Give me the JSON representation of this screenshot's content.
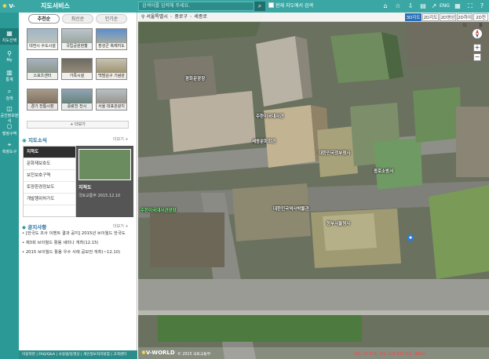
{
  "header": {
    "logo_text": "V-WORLD",
    "title": "지도서비스",
    "search_placeholder": "검색어를 입력해 주세요.",
    "search_in_map_label": "현재 지도에서 검색",
    "lang_label": "ENG",
    "accent_color": "#3aa7a4"
  },
  "leftnav": {
    "items": [
      {
        "label": "지도선택",
        "icon": "map-select-icon"
      },
      {
        "label": "My",
        "icon": "person-icon"
      },
      {
        "label": "통계",
        "icon": "stats-icon"
      },
      {
        "label": "검색",
        "icon": "search-icon"
      },
      {
        "label": "공간정보분석",
        "icon": "analysis-icon"
      },
      {
        "label": "행정구역",
        "icon": "region-icon"
      },
      {
        "label": "측정도구",
        "icon": "measure-icon"
      }
    ]
  },
  "panel": {
    "tabs": [
      "추천순",
      "최신순",
      "인기순"
    ],
    "thumbnails": [
      {
        "caption": "대전시 수도시설"
      },
      {
        "caption": "국립공원현황"
      },
      {
        "caption": "장성군 축제지도"
      },
      {
        "caption": "스포츠센터"
      },
      {
        "caption": "가족시설"
      },
      {
        "caption": "백범김구 기념관"
      },
      {
        "caption": "경기 전통시장"
      },
      {
        "caption": "중랑천 전시"
      },
      {
        "caption": "서울 대표관광지"
      }
    ],
    "more_label": "+ 더보기",
    "news_title": "지도소식",
    "news_more": "더보기 +",
    "news_items": [
      "지적도",
      "문화재보호도",
      "보전보호구역",
      "토양환경정보도",
      "개발행위허가도"
    ],
    "news_card": {
      "title": "지적도",
      "subtitle": "국토교통부 2015.12.10"
    },
    "notice_title": "공지사항",
    "notice_more": "더보기 +",
    "notices": [
      "[한국도 조사 이벤트 결과 공지] 2015년 브이월드 한국도",
      "제3회 브이월드 활용 세미나 개최(12.15)",
      "2015 브이월드 활용 우수 사례 공모전 개최(~12.10)"
    ],
    "footer_text": "이용약관 | FAQ/Q&A | 사용법/동영상 | 개인정보처리방침 | 고객센터"
  },
  "map": {
    "breadcrumb": [
      "서울특별시",
      "중로구",
      "세종로"
    ],
    "view_modes": [
      "3D지도",
      "2D지도",
      "2D영상",
      "2D하이브",
      "2D전통"
    ],
    "active_view": "3D지도",
    "labels": [
      {
        "text": "주한미국대사관"
      },
      {
        "text": "대한민국역사박물관"
      },
      {
        "text": "광화문광장"
      },
      {
        "text": "세종문화회관"
      },
      {
        "text": "대한민국정부청사"
      },
      {
        "text": "정부서울청사"
      },
      {
        "text": "종로소방서"
      },
      {
        "text": "주한미국대사관광장"
      }
    ],
    "brand": "V-WORLD",
    "copyright": "© 2015 국토교통부",
    "coords": "위도: 37.574, 경도: 126.977 고도: 480m"
  }
}
